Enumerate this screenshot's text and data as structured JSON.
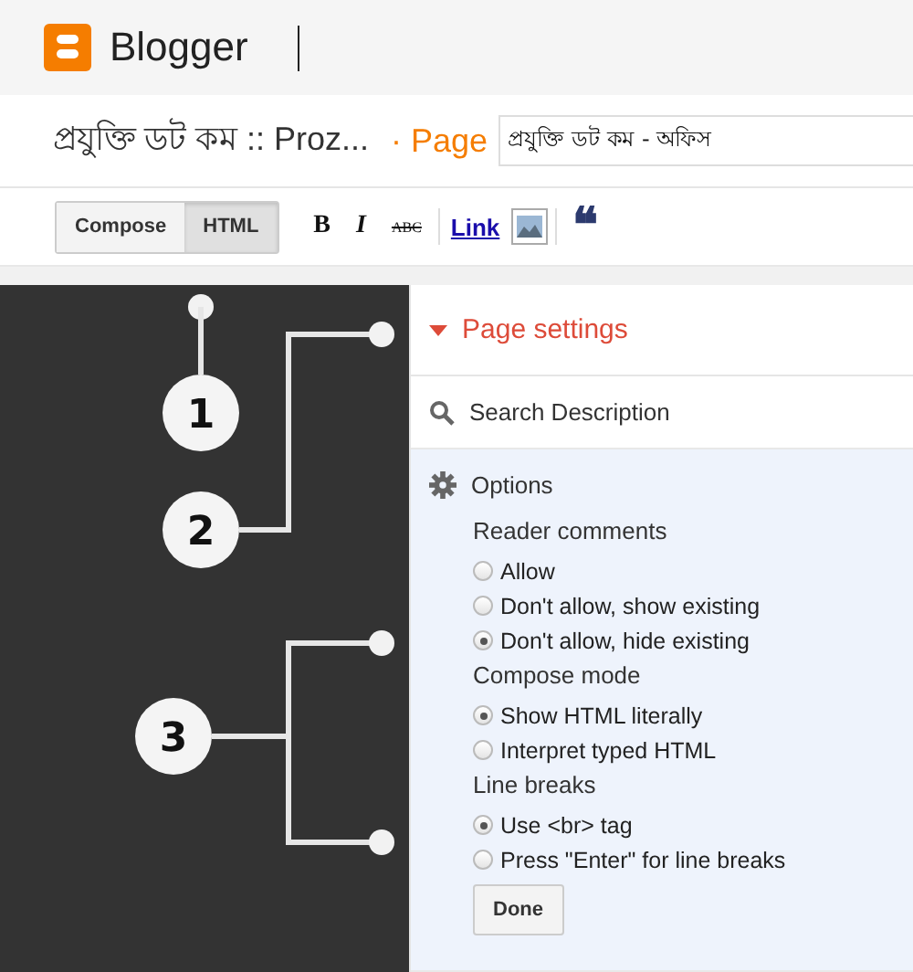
{
  "app": {
    "name": "Blogger"
  },
  "page_header": {
    "blog_title": "প্রযুক্তি ডট কম :: Proz...",
    "page_label": "· Page",
    "title_field": {
      "value": "প্রযুক্তি ডট কম - অফিস"
    }
  },
  "editor_tabs": [
    {
      "label": "Compose",
      "selected": false
    },
    {
      "label": "HTML",
      "selected": true
    }
  ],
  "toolbar": [
    {
      "kind": "bold",
      "label": "B"
    },
    {
      "kind": "italic",
      "label": "I"
    },
    {
      "kind": "strike",
      "label": "ABC"
    },
    {
      "kind": "divider"
    },
    {
      "kind": "link",
      "label": "Link"
    },
    {
      "kind": "image"
    },
    {
      "kind": "divider"
    },
    {
      "kind": "quote",
      "label": "❝"
    }
  ],
  "callouts": [
    "1",
    "2",
    "3"
  ],
  "settings": {
    "title": "Page settings",
    "expanded": true,
    "sections": [
      {
        "kind": "search",
        "label": "Search Description",
        "expanded": false
      },
      {
        "kind": "options",
        "label": "Options",
        "expanded": true
      }
    ],
    "groups": [
      {
        "label": "Reader comments",
        "options": [
          {
            "label": "Allow",
            "selected": false
          },
          {
            "label": "Don't allow, show existing",
            "selected": false
          },
          {
            "label": "Don't allow, hide existing",
            "selected": true
          }
        ]
      },
      {
        "label": "Compose mode",
        "options": [
          {
            "label": "Show HTML literally",
            "selected": true
          },
          {
            "label": "Interpret typed HTML",
            "selected": false
          }
        ]
      },
      {
        "label": "Line breaks",
        "options": [
          {
            "label": "Use <br> tag",
            "selected": true
          },
          {
            "label": "Press \"Enter\" for line breaks",
            "selected": false
          }
        ]
      }
    ],
    "done_button": "Done"
  }
}
